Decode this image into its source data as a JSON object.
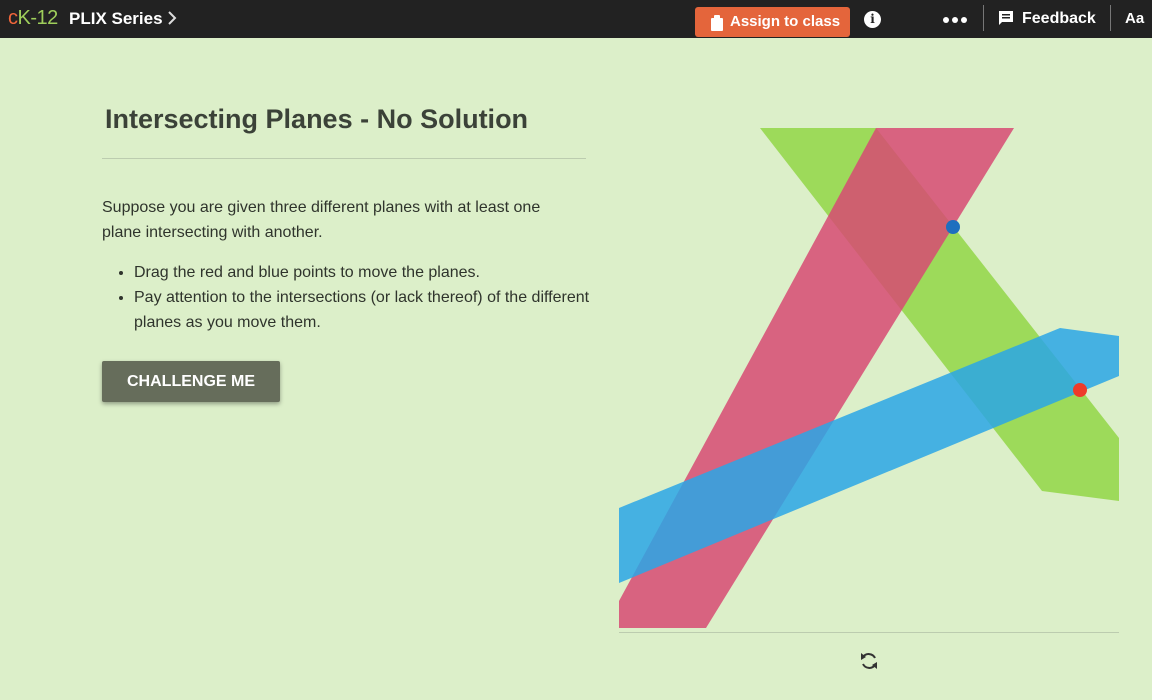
{
  "app": {
    "logo_c": "c",
    "logo_k": "K-12",
    "series": "PLIX Series",
    "series_chevron_icon": "chevron-right-icon",
    "assign_label": "Assign to class",
    "assign_icon": "clipboard-icon",
    "info_label": "i",
    "more_icon": "more-dots-icon",
    "feedback_label": "Feedback",
    "feedback_icon": "feedback-icon",
    "font_size_label": "Aa",
    "colors": {
      "topbar": "#222222",
      "assign": "#e4653b",
      "background": "#dcefc9",
      "button": "#666d5b"
    }
  },
  "content": {
    "title": "Intersecting Planes - No Solution",
    "intro": "Suppose you are given three different planes with at least one plane intersecting with another.",
    "bullets": [
      "Drag the red and blue points to move the planes.",
      "Pay attention to the intersections (or lack thereof) of the different planes as you move them."
    ],
    "challenge_label": "CHALLENGE ME"
  },
  "interactive": {
    "planes": [
      {
        "name": "green plane",
        "color": "#8dd43f"
      },
      {
        "name": "red plane",
        "color": "#d74a73"
      },
      {
        "name": "blue plane",
        "color": "#2aa6e6"
      }
    ],
    "handles": [
      {
        "name": "blue point",
        "color": "#1e6fbf"
      },
      {
        "name": "red point",
        "color": "#ee3b2a"
      }
    ],
    "reset_icon": "refresh-icon"
  }
}
